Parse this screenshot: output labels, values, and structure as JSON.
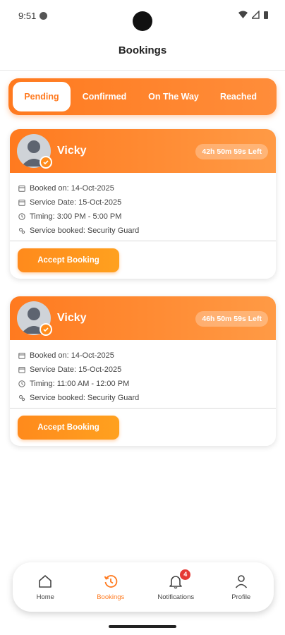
{
  "status_bar": {
    "time": "9:51"
  },
  "header": {
    "title": "Bookings"
  },
  "tabs": [
    {
      "label": "Pending",
      "active": true
    },
    {
      "label": "Confirmed",
      "active": false
    },
    {
      "label": "On The Way",
      "active": false
    },
    {
      "label": "Reached",
      "active": false
    }
  ],
  "bookings": [
    {
      "customer_name": "Vicky",
      "time_left": "42h 50m 59s Left",
      "booked_on": "Booked on: 14-Oct-2025",
      "service_date": "Service Date: 15-Oct-2025",
      "timing": "Timing: 3:00 PM - 5:00 PM",
      "service": "Service booked: Security Guard",
      "action_label": "Accept Booking"
    },
    {
      "customer_name": "Vicky",
      "time_left": "46h 50m 59s Left",
      "booked_on": "Booked on: 14-Oct-2025",
      "service_date": "Service Date: 15-Oct-2025",
      "timing": "Timing: 11:00 AM - 12:00 PM",
      "service": "Service booked: Security Guard",
      "action_label": "Accept Booking"
    }
  ],
  "bottom_nav": {
    "items": [
      {
        "label": "Home",
        "icon": "home-icon",
        "active": false
      },
      {
        "label": "Bookings",
        "icon": "history-icon",
        "active": true
      },
      {
        "label": "Notifications",
        "icon": "bell-icon",
        "active": false,
        "badge": "4"
      },
      {
        "label": "Profile",
        "icon": "person-icon",
        "active": false
      }
    ]
  },
  "colors": {
    "accent": "#ff7a1f",
    "badge": "#e53935"
  }
}
